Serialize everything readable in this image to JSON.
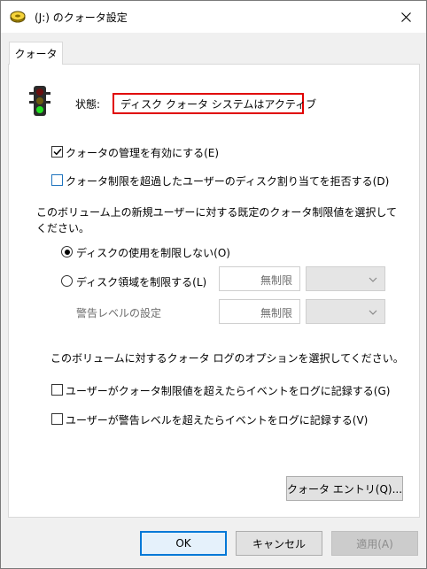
{
  "window": {
    "title": "(J:) のクォータ設定",
    "icon": "drive-icon",
    "close_label": "✕"
  },
  "tabs": [
    {
      "label": "クォータ",
      "selected": true
    }
  ],
  "status": {
    "label": "状態:",
    "value": "ディスク クォータ システムはアクティブ",
    "icon": "traffic-light-icon"
  },
  "options": {
    "enable_quota": {
      "label": "クォータの管理を有効にする(E)",
      "checked": true
    },
    "deny_space": {
      "label": "クォータ制限を超過したユーザーのディスク割り当てを拒否する(D)",
      "checked": false
    }
  },
  "default_limit": {
    "prompt_line1": "このボリューム上の新規ユーザーに対する既定のクォータ制限値を選択して",
    "prompt_line2": "ください。",
    "no_limit": {
      "label": "ディスクの使用を制限しない(O)",
      "selected": true
    },
    "limit": {
      "label": "ディスク領域を制限する(L)",
      "selected": false,
      "value": "無制限"
    },
    "warning": {
      "label": "警告レベルの設定",
      "value": "無制限"
    }
  },
  "logging": {
    "prompt": "このボリュームに対するクォータ ログのオプションを選択してください。",
    "log_limit": {
      "label": "ユーザーがクォータ制限値を超えたらイベントをログに記録する(G)",
      "checked": false
    },
    "log_warning": {
      "label": "ユーザーが警告レベルを超えたらイベントをログに記録する(V)",
      "checked": false
    }
  },
  "buttons": {
    "entries": "クォータ エントリ(Q)...",
    "ok": "OK",
    "cancel": "キャンセル",
    "apply": "適用(A)"
  },
  "colors": {
    "status_border": "#e00000",
    "default_button_border": "#0078d7",
    "checkbox_blue": "#1e73be"
  }
}
